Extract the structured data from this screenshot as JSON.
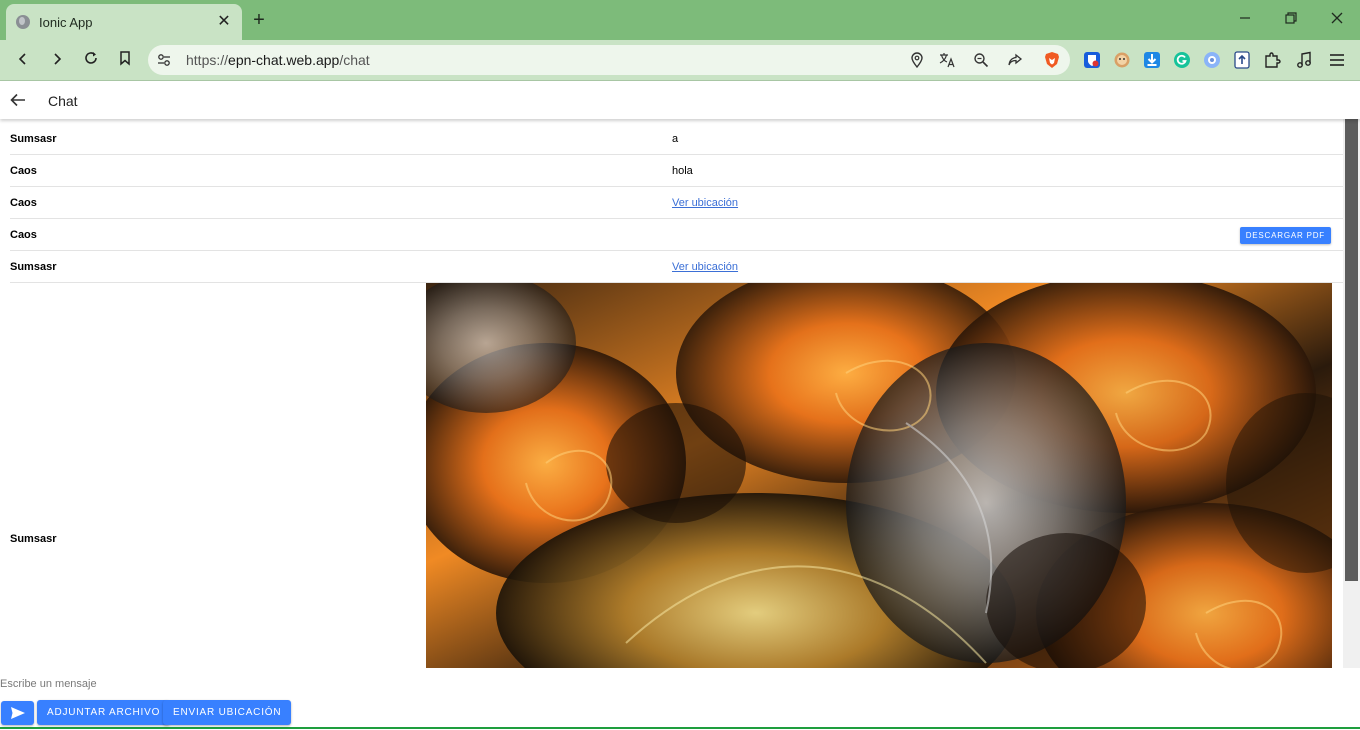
{
  "browser": {
    "tab_title": "Ionic App",
    "url_scheme": "https://",
    "url_host": "epn-chat.web.app",
    "url_path": "/chat"
  },
  "header": {
    "title": "Chat"
  },
  "messages": [
    {
      "sender": "Sumsasr",
      "type": "text",
      "text": "a"
    },
    {
      "sender": "Caos",
      "type": "text",
      "text": "hola"
    },
    {
      "sender": "Caos",
      "type": "location",
      "text": "Ver ubicación"
    },
    {
      "sender": "Caos",
      "type": "pdf",
      "text": "DESCARGAR PDF"
    },
    {
      "sender": "Sumsasr",
      "type": "location",
      "text": "Ver ubicación"
    },
    {
      "sender": "Sumsasr",
      "type": "image",
      "text": ""
    }
  ],
  "composer": {
    "placeholder": "Escribe un mensaje",
    "attach_label": "ADJUNTAR ARCHIVO",
    "location_label": "ENVIAR UBICACIÓN"
  },
  "colors": {
    "chrome_frame": "#7dbb7a",
    "chrome_toolbar": "#c9e3c5",
    "ionic_primary": "#3880ff",
    "link": "#3b6fd6"
  }
}
